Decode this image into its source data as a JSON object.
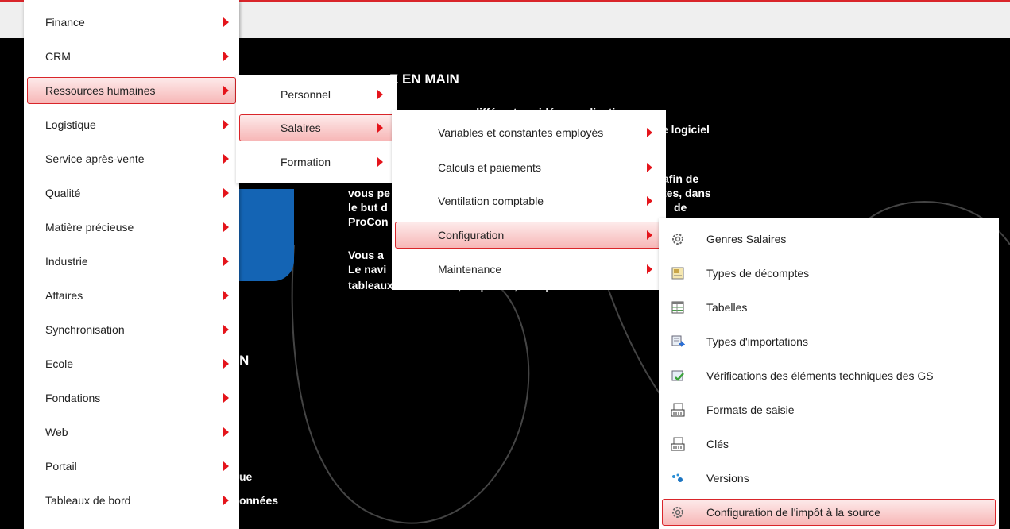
{
  "background": {
    "title_fragment": "E EN MAIN",
    "lines": [
      "age regroupe différentes vidéos explicatives vous",
      "e logiciel",
      "afin de",
      "vous pe",
      "tes, dans",
      "le but d",
      "de",
      "ProCon",
      "Vous a",
      "Le navi",
      "tableaux de données, Le portail, Mes préférences",
      "N",
      "ue",
      "onnées"
    ]
  },
  "menu_main": {
    "items": [
      {
        "label": "Finance"
      },
      {
        "label": "CRM"
      },
      {
        "label": "Ressources humaines",
        "active": true
      },
      {
        "label": "Logistique"
      },
      {
        "label": "Service après-vente"
      },
      {
        "label": "Qualité"
      },
      {
        "label": "Matière précieuse"
      },
      {
        "label": "Industrie"
      },
      {
        "label": "Affaires"
      },
      {
        "label": "Synchronisation"
      },
      {
        "label": "Ecole"
      },
      {
        "label": "Fondations"
      },
      {
        "label": "Web"
      },
      {
        "label": "Portail"
      },
      {
        "label": "Tableaux de bord"
      }
    ]
  },
  "menu_hr": {
    "items": [
      {
        "label": "Personnel"
      },
      {
        "label": "Salaires",
        "active": true
      },
      {
        "label": "Formation"
      }
    ]
  },
  "menu_salaires": {
    "items": [
      {
        "label": "Variables et constantes employés"
      },
      {
        "label": "Calculs et paiements"
      },
      {
        "label": "Ventilation comptable"
      },
      {
        "label": "Configuration",
        "active": true
      },
      {
        "label": "Maintenance"
      }
    ]
  },
  "menu_configuration": {
    "items": [
      {
        "label": "Genres Salaires",
        "icon": "gear-icon"
      },
      {
        "label": "Types de décomptes",
        "icon": "document-icon"
      },
      {
        "label": "Tabelles",
        "icon": "table-icon"
      },
      {
        "label": "Types d'importations",
        "icon": "import-icon"
      },
      {
        "label": "Vérifications des éléments techniques des GS",
        "icon": "check-icon"
      },
      {
        "label": "Formats de saisie",
        "icon": "keyboard-icon"
      },
      {
        "label": "Clés",
        "icon": "keyboard-icon"
      },
      {
        "label": "Versions",
        "icon": "dots-icon"
      },
      {
        "label": "Configuration de l'impôt à la source",
        "icon": "gear-icon",
        "active": true
      }
    ]
  },
  "colors": {
    "accent": "#e4141b",
    "active_border": "#d9252a",
    "active_bg_top": "#fdeaea",
    "active_bg_bottom": "#f7b7b7",
    "stage_bg": "#000000",
    "blue": "#1464b4"
  }
}
